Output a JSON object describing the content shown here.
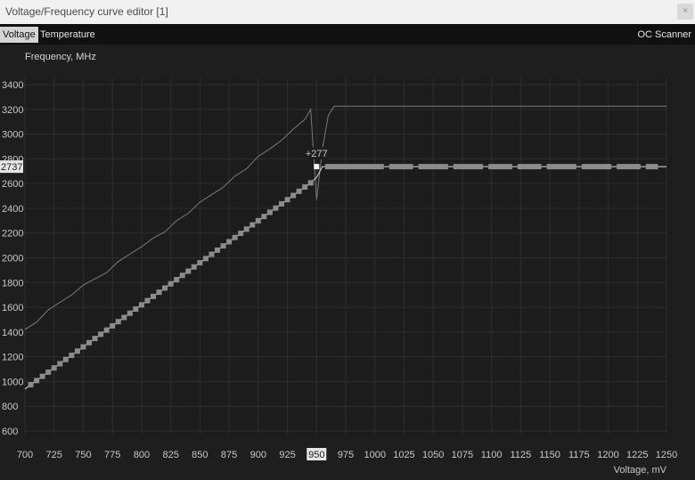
{
  "window": {
    "title": "Voltage/Frequency curve editor [1]",
    "close_label": "×"
  },
  "tabs": [
    {
      "label": "Voltage",
      "active": true
    },
    {
      "label": "Temperature",
      "active": false
    }
  ],
  "oc_scanner_label": "OC Scanner",
  "chart_data": {
    "type": "line",
    "xlabel": "Voltage, mV",
    "ylabel": "Frequency, MHz",
    "xlim": [
      700,
      1250
    ],
    "ylim": [
      600,
      3400
    ],
    "xticks": [
      700,
      725,
      750,
      775,
      800,
      825,
      850,
      875,
      900,
      925,
      950,
      975,
      1000,
      1025,
      1050,
      1075,
      1100,
      1125,
      1150,
      1175,
      1200,
      1225,
      1250
    ],
    "yticks": [
      600,
      800,
      1000,
      1200,
      1400,
      1600,
      1800,
      2000,
      2200,
      2400,
      2600,
      2800,
      3000,
      3200,
      3400
    ],
    "grid": true,
    "series": [
      {
        "style": "thin-gray",
        "x": [
          700,
          710,
          720,
          730,
          740,
          750,
          760,
          770,
          780,
          790,
          800,
          810,
          820,
          830,
          840,
          850,
          860,
          870,
          880,
          890,
          900,
          910,
          920,
          930,
          940,
          945,
          950,
          955,
          960,
          965,
          1250
        ],
        "y": [
          1420,
          1480,
          1580,
          1640,
          1700,
          1780,
          1830,
          1880,
          1970,
          2030,
          2090,
          2160,
          2210,
          2300,
          2360,
          2450,
          2510,
          2570,
          2660,
          2720,
          2820,
          2880,
          2950,
          3040,
          3120,
          3200,
          2470,
          2880,
          3150,
          3225,
          3225
        ]
      },
      {
        "style": "curve-with-points",
        "x": [
          700,
          705,
          710,
          715,
          720,
          725,
          730,
          735,
          740,
          745,
          750,
          755,
          760,
          765,
          770,
          775,
          780,
          785,
          790,
          795,
          800,
          805,
          810,
          815,
          820,
          825,
          830,
          835,
          840,
          845,
          850,
          855,
          860,
          865,
          870,
          875,
          880,
          885,
          890,
          895,
          900,
          905,
          910,
          915,
          920,
          925,
          930,
          935,
          940,
          945,
          950,
          955,
          1250
        ],
        "y": [
          940,
          974,
          1008,
          1042,
          1076,
          1110,
          1144,
          1178,
          1212,
          1246,
          1280,
          1314,
          1348,
          1382,
          1416,
          1450,
          1484,
          1518,
          1552,
          1586,
          1620,
          1654,
          1688,
          1722,
          1756,
          1790,
          1824,
          1858,
          1892,
          1926,
          1960,
          1994,
          2028,
          2062,
          2096,
          2130,
          2164,
          2198,
          2232,
          2266,
          2300,
          2334,
          2368,
          2402,
          2436,
          2470,
          2504,
          2538,
          2572,
          2606,
          2650,
          2737,
          2737
        ],
        "flat_points_x": [
          960,
          965,
          970,
          975,
          980,
          985,
          990,
          995,
          1000,
          1005,
          1015,
          1020,
          1025,
          1030,
          1040,
          1045,
          1050,
          1055,
          1060,
          1070,
          1075,
          1080,
          1085,
          1090,
          1100,
          1105,
          1110,
          1115,
          1125,
          1130,
          1135,
          1140,
          1150,
          1155,
          1160,
          1165,
          1170,
          1180,
          1185,
          1190,
          1195,
          1200,
          1210,
          1215,
          1220,
          1225,
          1235,
          1240
        ]
      }
    ],
    "selected_point": {
      "x": 950,
      "y": 2737,
      "offset_label": "+277",
      "x_label": "950",
      "y_label": "2737"
    }
  }
}
